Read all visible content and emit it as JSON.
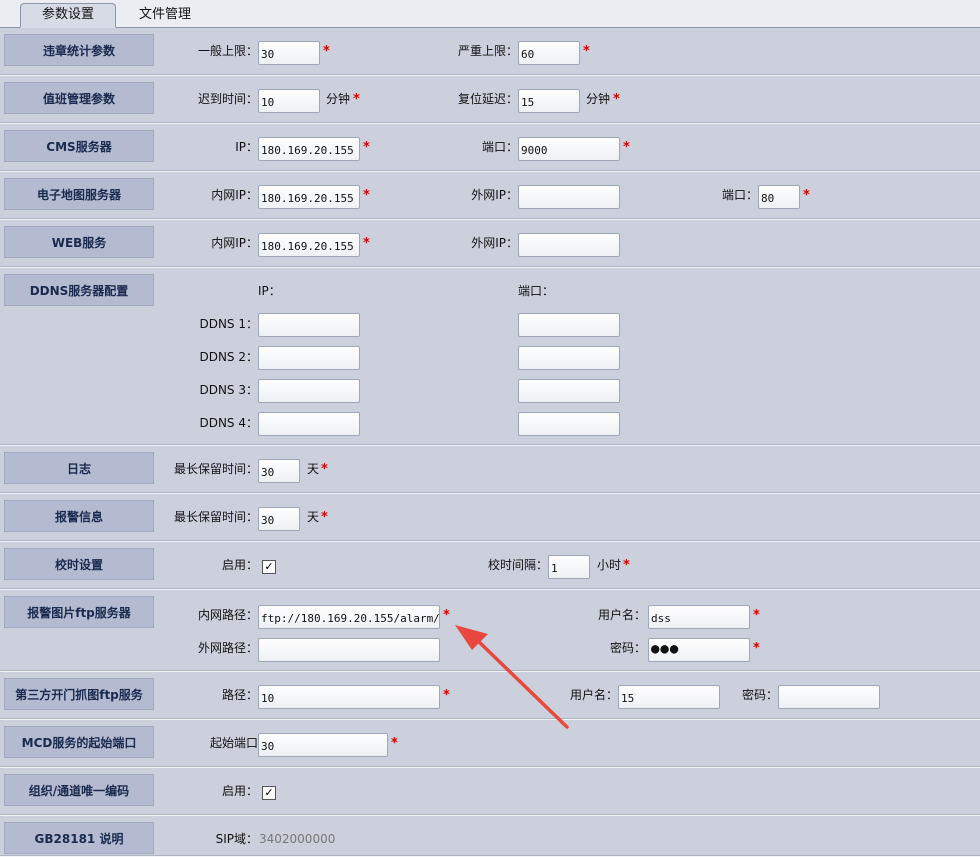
{
  "tabs": [
    {
      "label": "参数设置"
    },
    {
      "label": "文件管理"
    }
  ],
  "violation": {
    "title": "违章统计参数",
    "general_label": "一般上限：",
    "general_value": "30",
    "severe_label": "严重上限：",
    "severe_value": "60"
  },
  "duty": {
    "title": "值班管理参数",
    "late_label": "迟到时间：",
    "late_value": "10",
    "late_unit": "分钟",
    "reset_label": "复位延迟：",
    "reset_value": "15",
    "reset_unit": "分钟"
  },
  "cms": {
    "title": "CMS服务器",
    "ip_label": "IP：",
    "ip_value": "180.169.20.155",
    "port_label": "端口：",
    "port_value": "9000"
  },
  "emap": {
    "title": "电子地图服务器",
    "lan_label": "内网IP：",
    "lan_value": "180.169.20.155",
    "wan_label": "外网IP：",
    "wan_value": "",
    "port_label": "端口：",
    "port_value": "80"
  },
  "web": {
    "title": "WEB服务",
    "lan_label": "内网IP：",
    "lan_value": "180.169.20.155",
    "wan_label": "外网IP：",
    "wan_value": ""
  },
  "ddns": {
    "title": "DDNS服务器配置",
    "ip_header": "IP：",
    "port_header": "端口：",
    "rows": [
      {
        "label": "DDNS 1：",
        "ip": "",
        "port": ""
      },
      {
        "label": "DDNS 2：",
        "ip": "",
        "port": ""
      },
      {
        "label": "DDNS 3：",
        "ip": "",
        "port": ""
      },
      {
        "label": "DDNS 4：",
        "ip": "",
        "port": ""
      }
    ]
  },
  "log": {
    "title": "日志",
    "keep_label": "最长保留时间：",
    "keep_value": "30",
    "unit": "天"
  },
  "alarm_info": {
    "title": "报警信息",
    "keep_label": "最长保留时间：",
    "keep_value": "30",
    "unit": "天"
  },
  "timesync": {
    "title": "校时设置",
    "enable_label": "启用：",
    "enable_checked": "✓",
    "interval_label": "校时间隔：",
    "interval_value": "1",
    "interval_unit": "小时"
  },
  "alarm_ftp": {
    "title": "报警图片ftp服务器",
    "lan_label": "内网路径：",
    "lan_value": "ftp://180.169.20.155/alarm/",
    "wan_label": "外网路径：",
    "wan_value": "",
    "user_label": "用户名：",
    "user_value": "dss",
    "pw_label": "密码：",
    "pw_value": "●●●"
  },
  "third_ftp": {
    "title": "第三方开门抓图ftp服务",
    "path_label": "路径：",
    "path_value": "10",
    "user_label": "用户名：",
    "user_value": "15",
    "pw_label": "密码：",
    "pw_value": ""
  },
  "mcd": {
    "title": "MCD服务的起始端口",
    "start_label": "起始端口",
    "start_value": "30"
  },
  "org": {
    "title": "组织/通道唯一编码",
    "enable_label": "启用：",
    "enable_checked": "✓"
  },
  "gb": {
    "title": "GB28181 说明",
    "sip_label": "SIP域：",
    "sip_value": "3402000000"
  },
  "colors": {
    "arrow": "#e8483f",
    "required_star": "#dd0000",
    "section_bg": "#ccd0dc",
    "title_bg": "#b4bbd0"
  }
}
